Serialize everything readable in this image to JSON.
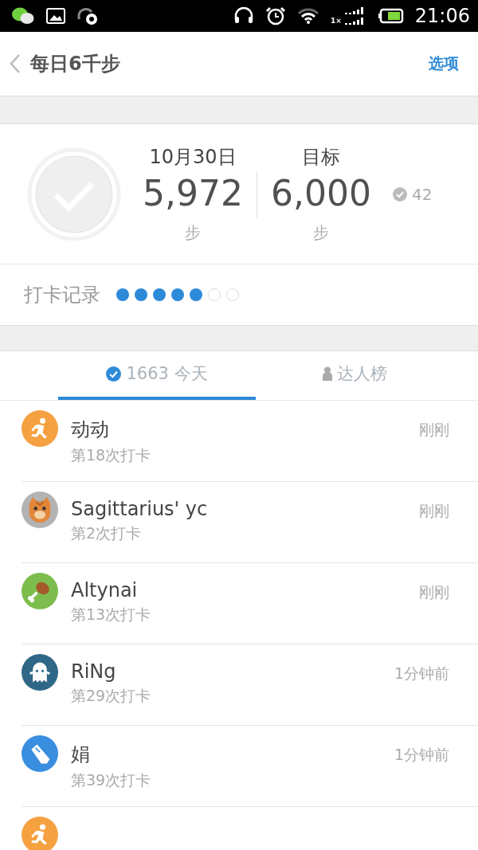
{
  "status_bar": {
    "network_label": "1×",
    "time": "21:06"
  },
  "header": {
    "title": "每日6千步",
    "action": "选项"
  },
  "summary": {
    "done": true,
    "date": "10月30日",
    "steps": "5,972",
    "steps_unit": "步",
    "goal_label": "目标",
    "goal": "6,000",
    "goal_unit": "步",
    "completed_count": "42"
  },
  "record": {
    "label": "打卡记录",
    "days": [
      {
        "checked": true
      },
      {
        "checked": true
      },
      {
        "checked": true
      },
      {
        "checked": true
      },
      {
        "checked": true
      },
      {
        "checked": false
      },
      {
        "checked": false
      }
    ]
  },
  "tabs": [
    {
      "kind": "today",
      "count": "1663",
      "label": "今天",
      "selected": true
    },
    {
      "kind": "ranking",
      "label": "达人榜",
      "selected": false
    }
  ],
  "checkins": [
    {
      "kind": "runner",
      "color": "#f5a142",
      "name": "动动",
      "count": "第18次打卡",
      "time": "刚刚"
    },
    {
      "kind": "cat",
      "color": "#b3b3b3",
      "name": "Sagittarius' yc",
      "count": "第2次打卡",
      "time": "刚刚"
    },
    {
      "kind": "drumstick",
      "color": "#7dbd4e",
      "name": "Altynai",
      "count": "第13次打卡",
      "time": "刚刚"
    },
    {
      "kind": "ghost",
      "color": "#2f6886",
      "name": "RiNg",
      "count": "第29次打卡",
      "time": "1分钟前"
    },
    {
      "kind": "shoe",
      "color": "#3a8ee0",
      "name": "娟",
      "count": "第39次打卡",
      "time": "1分钟前"
    },
    {
      "kind": "runner",
      "color": "#f5a142"
    }
  ]
}
